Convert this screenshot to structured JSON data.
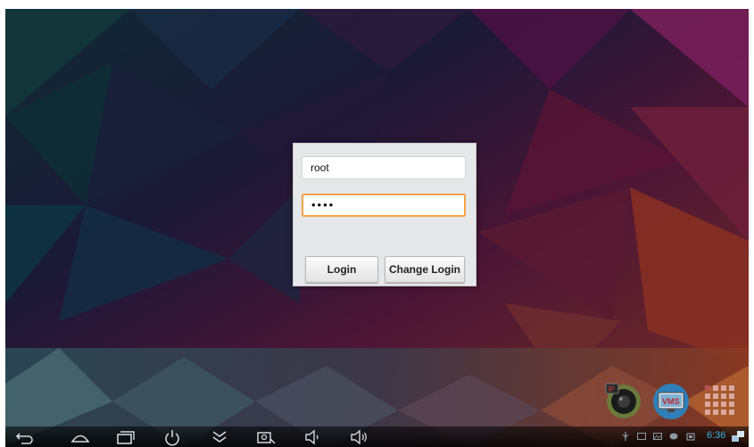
{
  "login_dialog": {
    "username_value": "root",
    "password_value": "••••",
    "login_label": "Login",
    "change_login_label": "Change Login"
  },
  "status_bar": {
    "clock": "6:36"
  },
  "desktop": {
    "apps": [
      {
        "name": "camera-app",
        "icon": "camera-lens-icon",
        "badge": "IP"
      },
      {
        "name": "vms-app",
        "icon": "vms-monitor-icon",
        "badge": "VMS"
      },
      {
        "name": "app-drawer",
        "icon": "app-grid-icon"
      }
    ]
  },
  "navigation": {
    "buttons": [
      "back-icon",
      "home-icon",
      "recent-apps-icon",
      "power-icon",
      "collapse-icon",
      "screenshot-icon",
      "volume-down-icon",
      "volume-up-icon"
    ]
  },
  "colors": {
    "accent_blue": "#34b5e5",
    "focus_orange": "#f4a34b",
    "dialog_bg": "#e6e7e8"
  }
}
